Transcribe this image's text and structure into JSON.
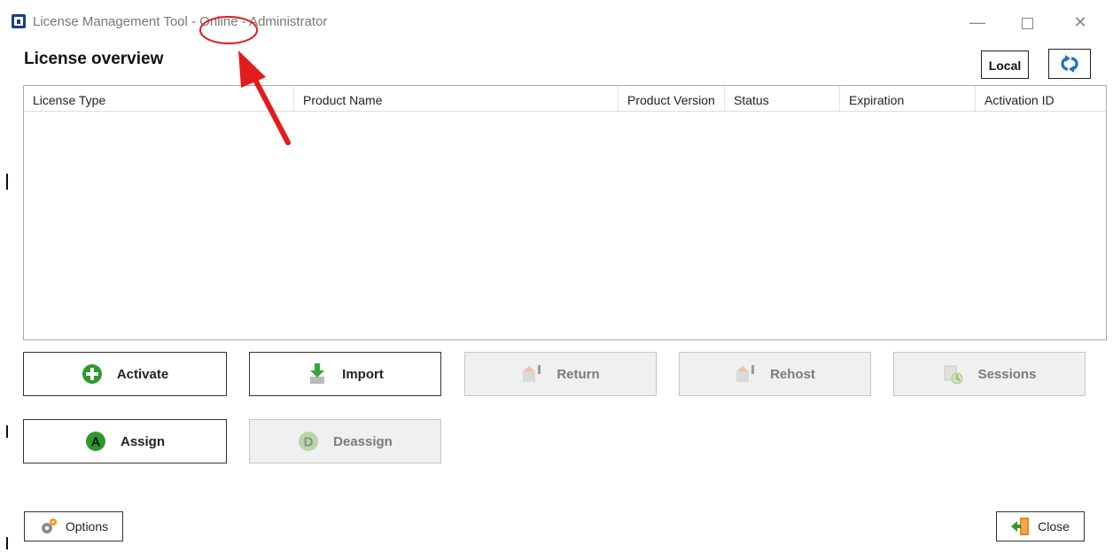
{
  "window": {
    "title_app": "License Management Tool",
    "title_sep1": " - ",
    "title_mode": "Online",
    "title_sep2": " - ",
    "title_user": "Administrator",
    "minimize_glyph": "—",
    "close_glyph": "✕"
  },
  "overview": {
    "title": "License overview",
    "local_label": "Local",
    "refresh_icon": "refresh-icon"
  },
  "grid": {
    "columns": [
      "License Type",
      "Product Name",
      "Product Version",
      "Status",
      "Expiration",
      "Activation ID"
    ],
    "rows": []
  },
  "actions": {
    "activate": "Activate",
    "import": "Import",
    "return": "Return",
    "rehost": "Rehost",
    "sessions": "Sessions",
    "assign": "Assign",
    "deassign": "Deassign"
  },
  "footer": {
    "options": "Options",
    "close": "Close"
  },
  "colors": {
    "accent_blue": "#1e73be",
    "activate_green": "#2e9a2e",
    "annotation_red": "#e41b1b"
  }
}
